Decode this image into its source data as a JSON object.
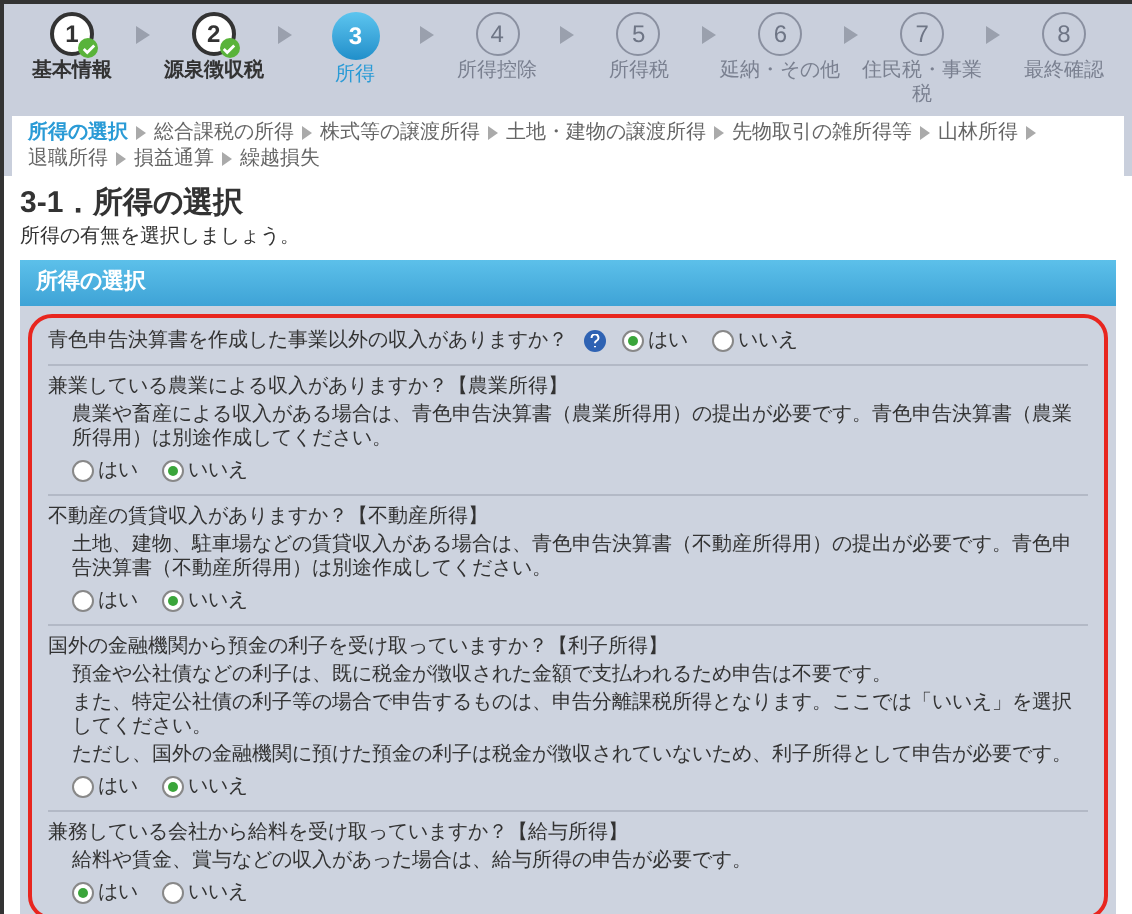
{
  "steps": [
    {
      "number": "1",
      "label": "基本情報",
      "completed": true,
      "selected": false
    },
    {
      "number": "2",
      "label": "源泉徴収税",
      "completed": true,
      "selected": false
    },
    {
      "number": "3",
      "label": "所得",
      "completed": false,
      "selected": true
    },
    {
      "number": "4",
      "label": "所得控除",
      "completed": false,
      "selected": false
    },
    {
      "number": "5",
      "label": "所得税",
      "completed": false,
      "selected": false
    },
    {
      "number": "6",
      "label": "延納・その他",
      "completed": false,
      "selected": false
    },
    {
      "number": "7",
      "label": "住民税・事業税",
      "completed": false,
      "selected": false
    },
    {
      "number": "8",
      "label": "最終確認",
      "completed": false,
      "selected": false
    }
  ],
  "subtabs": [
    {
      "label": "所得の選択",
      "selected": true
    },
    {
      "label": "総合課税の所得",
      "selected": false
    },
    {
      "label": "株式等の譲渡所得",
      "selected": false
    },
    {
      "label": "土地・建物の譲渡所得",
      "selected": false
    },
    {
      "label": "先物取引の雑所得等",
      "selected": false
    },
    {
      "label": "山林所得",
      "selected": false
    },
    {
      "label": "退職所得",
      "selected": false
    },
    {
      "label": "損益通算",
      "selected": false
    },
    {
      "label": "繰越損失",
      "selected": false
    }
  ],
  "heading": "3-1．所得の選択",
  "intro": "所得の有無を選択しましょう。",
  "panel": {
    "title": "所得の選択",
    "questions": [
      {
        "kind": "inline",
        "question": "青色申告決算書を作成した事業以外の収入がありますか？",
        "options": [
          {
            "label": "はい",
            "selected": true
          },
          {
            "label": "いいえ",
            "selected": false
          }
        ]
      },
      {
        "kind": "block",
        "question": "兼業している農業による収入がありますか？【農業所得】",
        "description": [
          "農業や畜産による収入がある場合は、青色申告決算書（農業所得用）の提出が必要です。青色申告決算書（農業所得用）は別途作成してください。"
        ],
        "options": [
          {
            "label": "はい",
            "selected": false
          },
          {
            "label": "いいえ",
            "selected": true
          }
        ]
      },
      {
        "kind": "block",
        "question": "不動産の賃貸収入がありますか？【不動産所得】",
        "description": [
          "土地、建物、駐車場などの賃貸収入がある場合は、青色申告決算書（不動産所得用）の提出が必要です。青色申告決算書（不動産所得用）は別途作成してください。"
        ],
        "options": [
          {
            "label": "はい",
            "selected": false
          },
          {
            "label": "いいえ",
            "selected": true
          }
        ]
      },
      {
        "kind": "block",
        "question": "国外の金融機関から預金の利子を受け取っていますか？【利子所得】",
        "description": [
          "預金や公社債などの利子は、既に税金が徴収された金額で支払われるため申告は不要です。",
          "また、特定公社債の利子等の場合で申告するものは、申告分離課税所得となります。ここでは「いいえ」を選択してください。",
          "ただし、国外の金融機関に預けた預金の利子は税金が徴収されていないため、利子所得として申告が必要です。"
        ],
        "options": [
          {
            "label": "はい",
            "selected": false
          },
          {
            "label": "いいえ",
            "selected": true
          }
        ]
      },
      {
        "kind": "block",
        "question": "兼務している会社から給料を受け取っていますか？【給与所得】",
        "description": [
          "給料や賃金、賞与などの収入があった場合は、給与所得の申告が必要です。"
        ],
        "options": [
          {
            "label": "はい",
            "selected": true
          },
          {
            "label": "いいえ",
            "selected": false
          }
        ]
      }
    ]
  }
}
